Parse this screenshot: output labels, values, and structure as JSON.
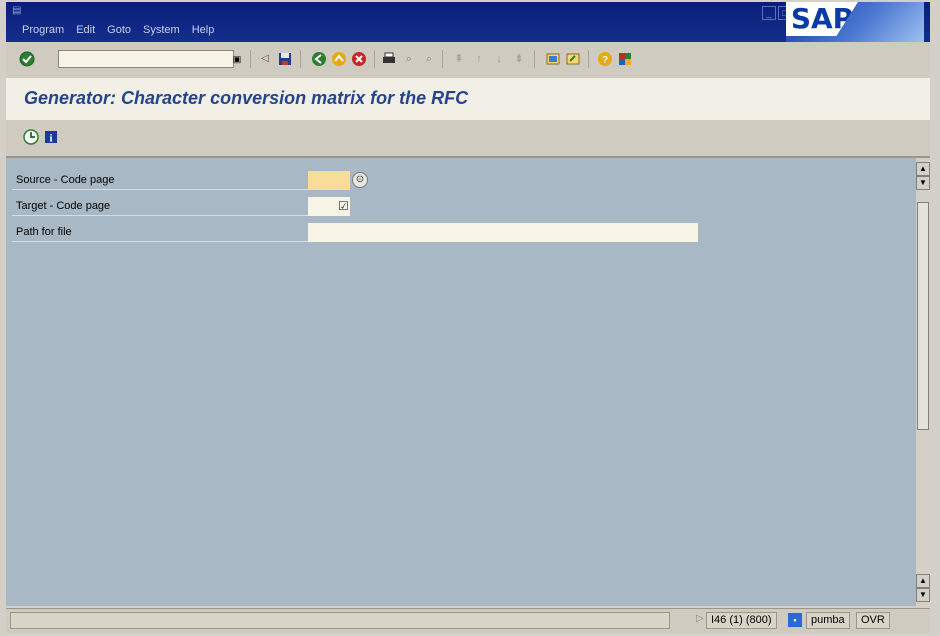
{
  "menubar": {
    "items": [
      "Program",
      "Edit",
      "Goto",
      "System",
      "Help"
    ],
    "logo": "SAP"
  },
  "toolbar": {
    "icons": [
      "enter-icon",
      "command-field",
      "save-icon",
      "back-icon",
      "exit-icon",
      "cancel-icon",
      "print-icon",
      "find-icon",
      "find-next-icon",
      "first-page-icon",
      "previous-page-icon",
      "next-page-icon",
      "last-page-icon",
      "create-session-icon",
      "create-shortcut-icon",
      "help-icon",
      "layout-icon"
    ]
  },
  "title": "Generator: Character conversion matrix for the RFC",
  "app_toolbar": {
    "icons": [
      "execute-icon",
      "info-icon"
    ]
  },
  "form": {
    "fields": [
      {
        "label": "Source - Code page",
        "value": "",
        "required": true
      },
      {
        "label": "Target - Code page",
        "value": "",
        "checkbox": true
      },
      {
        "label": "Path for file",
        "value": ""
      }
    ]
  },
  "status": {
    "system": "I46 (1) (800)",
    "server": "pumba",
    "mode": "OVR"
  },
  "colors": {
    "menubar": "#0a1e7a",
    "content_bg": "#a8b8c4",
    "title": "#25448f",
    "required_field": "#f8dc98"
  }
}
